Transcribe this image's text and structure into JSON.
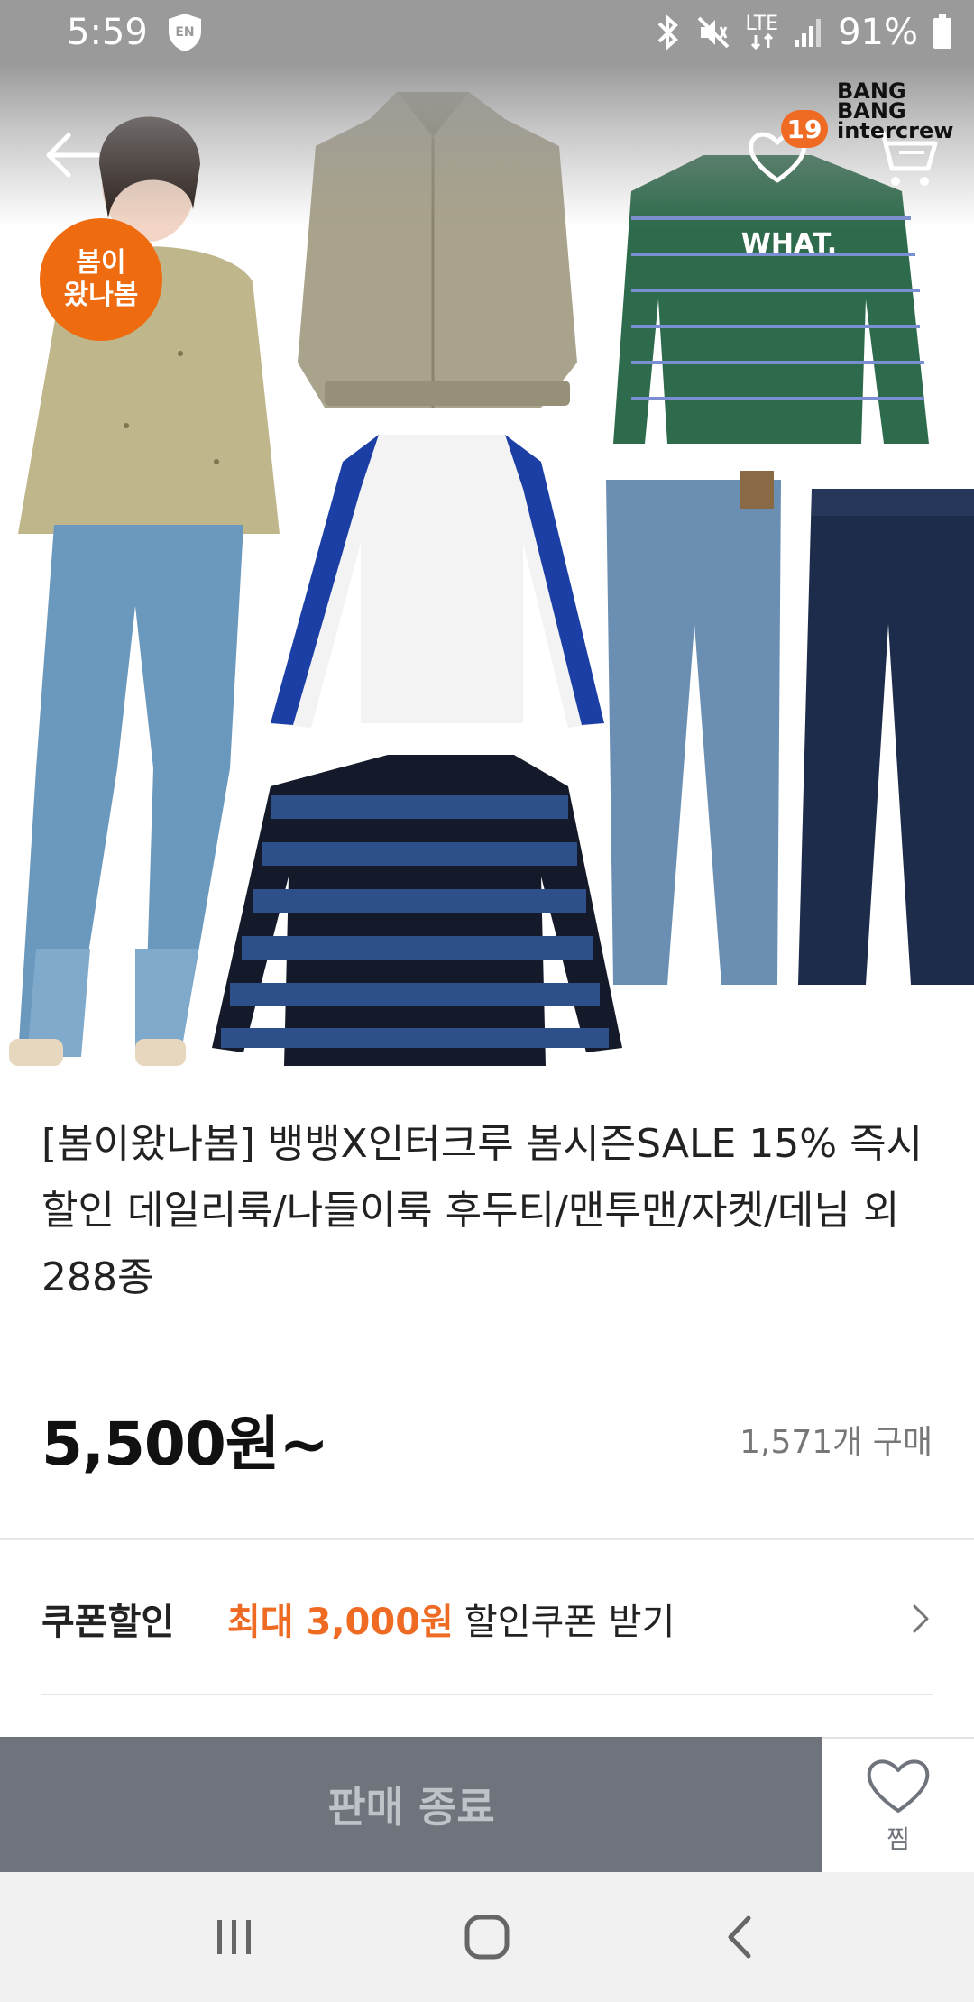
{
  "status_bar": {
    "time": "5:59",
    "keyboard_badge": "EN",
    "network": "LTE",
    "battery": "91%"
  },
  "header": {
    "wish_count": "19",
    "brand_line1": "BANG BANG",
    "brand_line2": "intercrew"
  },
  "hero": {
    "badge_line1": "봄이",
    "badge_line2": "왔나봄",
    "shirt_text": "WHAT."
  },
  "product": {
    "title": "[봄이왔나봄] 뱅뱅X인터크루 봄시즌SALE 15% 즉시할인 데일리룩/나들이룩 후두티/맨투맨/자켓/데님 외 288종",
    "price": "5,500원~",
    "purchase_count": "1,571개 구매"
  },
  "coupon": {
    "label": "쿠폰할인",
    "highlight": "최대 3,000원",
    "text": "할인쿠폰 받기"
  },
  "action_bar": {
    "sold_out_label": "판매 종료",
    "zzim_label": "찜"
  },
  "colors": {
    "accent": "#ef6b23",
    "sold_out_bg": "#6f747c",
    "status_bar_bg": "#9a9a9a"
  },
  "icons": [
    "back-arrow-icon",
    "heart-icon",
    "cart-icon",
    "chevron-right-icon",
    "recent-apps-icon",
    "home-icon",
    "back-icon"
  ]
}
